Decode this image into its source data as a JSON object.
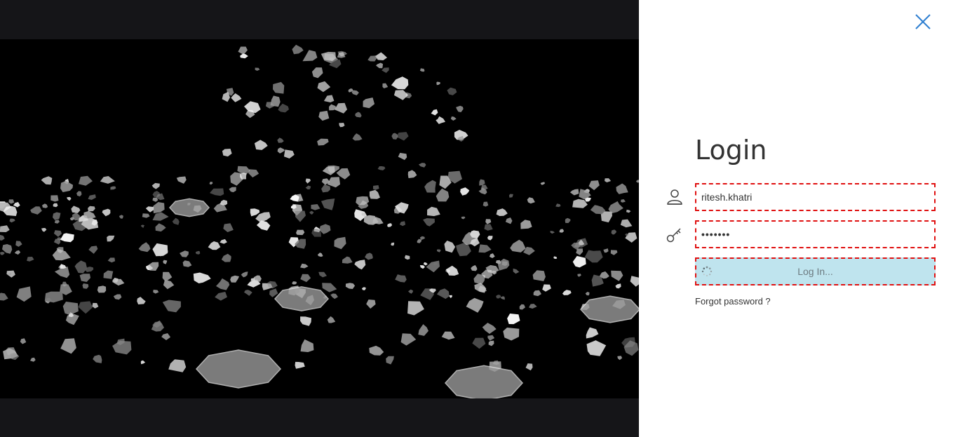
{
  "login": {
    "title": "Login",
    "username_value": "ritesh.khatri",
    "password_value": "•••••••",
    "submit_label": "Log In...",
    "forgot_password_label": "Forgot password ?"
  },
  "icons": {
    "close": "close-icon",
    "user": "user-icon",
    "key": "key-icon",
    "spinner": "spinner-icon"
  },
  "colors": {
    "media_frame": "#151518",
    "media_background": "#000000",
    "panel_background": "#ffffff",
    "close_icon": "#2f7fd1",
    "field_error_border": "#e01010",
    "button_background": "#bfe4ee",
    "text": "#333333"
  }
}
